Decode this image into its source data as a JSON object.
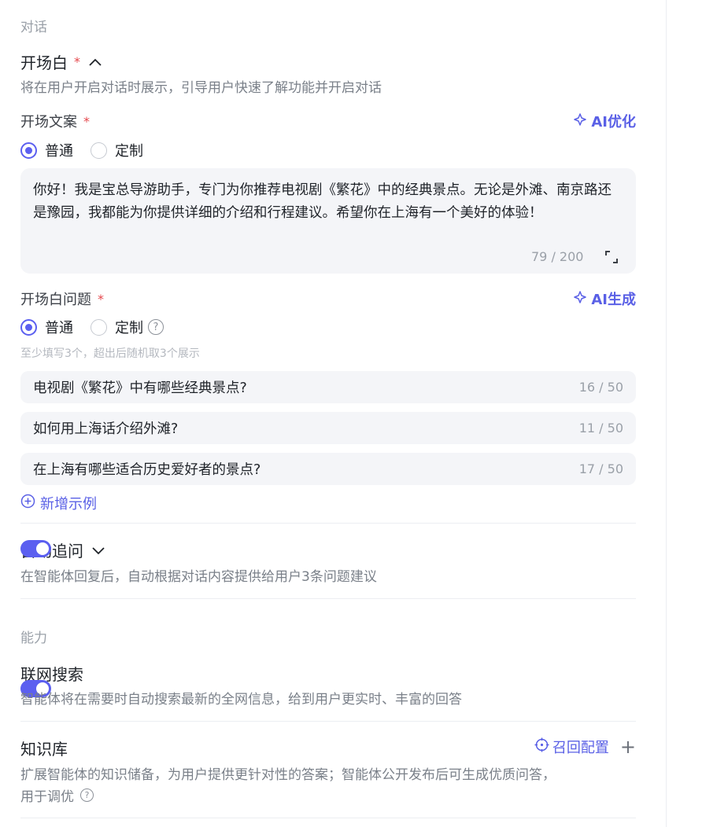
{
  "dialog": {
    "section_label": "对话",
    "opening": {
      "title": "开场白",
      "required_mark": "*",
      "description": "将在用户开启对话时展示，引导用户快速了解功能并开启对话",
      "copy_label": "开场文案",
      "ai_optimize": "AI优化",
      "radio_normal": "普通",
      "radio_custom": "定制",
      "text": "你好！我是宝总导游助手，专门为你推荐电视剧《繁花》中的经典景点。无论是外滩、南京路还是豫园，我都能为你提供详细的介绍和行程建议。希望你在上海有一个美好的体验！",
      "counter": "79 / 200"
    },
    "questions": {
      "label": "开场白问题",
      "ai_generate": "AI生成",
      "radio_normal": "普通",
      "radio_custom": "定制",
      "hint": "至少填写3个，超出后随机取3个展示",
      "items": [
        {
          "text": "电视剧《繁花》中有哪些经典景点?",
          "count": "16 / 50"
        },
        {
          "text": "如何用上海话介绍外滩?",
          "count": "11 / 50"
        },
        {
          "text": "在上海有哪些适合历史爱好者的景点?",
          "count": "17 / 50"
        }
      ],
      "add_example": "新增示例"
    },
    "auto_followup": {
      "title": "自动追问",
      "description": "在智能体回复后，自动根据对话内容提供给用户3条问题建议",
      "enabled": true
    }
  },
  "ability": {
    "section_label": "能力",
    "web_search": {
      "title": "联网搜索",
      "description": "智能体将在需要时自动搜索最新的全网信息，给到用户更实时、丰富的回答",
      "enabled": true
    },
    "knowledge": {
      "title": "知识库",
      "recall_config": "召回配置",
      "description_line1": "扩展智能体的知识储备，为用户提供更针对性的答案；智能体公开发布后可生成优质问答，",
      "description_line2": "用于调优"
    }
  },
  "colors": {
    "accent": "#5b5ff0",
    "required": "#e5484d",
    "field_bg": "#f4f5f8"
  }
}
